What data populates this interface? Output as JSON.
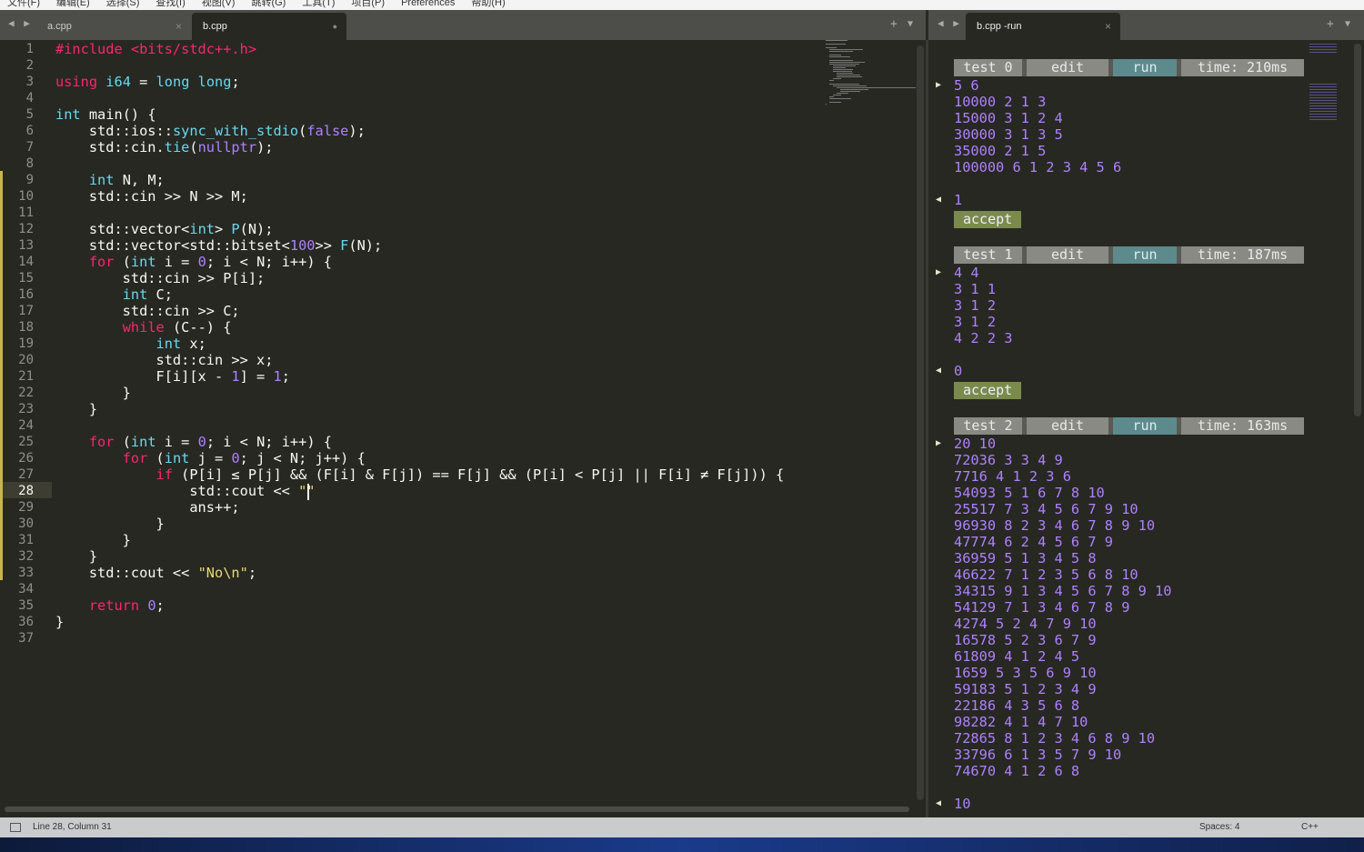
{
  "menu": [
    "文件(F)",
    "编辑(E)",
    "选择(S)",
    "查找(I)",
    "视图(V)",
    "跳转(G)",
    "工具(T)",
    "项目(P)",
    "Preferences",
    "帮助(H)"
  ],
  "left_tabs": [
    {
      "label": "a.cpp",
      "icon": "close-icon"
    },
    {
      "label": "b.cpp",
      "icon": "unsaved-dot-icon"
    }
  ],
  "right_tabs": [
    {
      "label": "b.cpp -run",
      "icon": "close-icon"
    }
  ],
  "icons": {
    "close": "×",
    "dot": "●",
    "nav": "◀ ▶",
    "plus": "+",
    "dropdown": "▼",
    "in_marker": "▶",
    "out_marker": "◀"
  },
  "colors": {
    "keyword": "#f92672",
    "type": "#66d9ef",
    "number": "#ae81ff",
    "string": "#e6db74",
    "background": "#272822"
  },
  "editor": {
    "current_line": 28,
    "lines": [
      [
        [
          "#include <bits/stdc++.h>",
          "k"
        ]
      ],
      [],
      [
        [
          "using",
          "k"
        ],
        [
          " "
        ],
        [
          "i64",
          "t"
        ],
        [
          " = "
        ],
        [
          "long long",
          "t"
        ],
        [
          ";"
        ]
      ],
      [],
      [
        [
          "int",
          "t"
        ],
        [
          " main() {"
        ]
      ],
      [
        [
          "    std::ios::"
        ],
        [
          "sync_with_stdio",
          "f"
        ],
        [
          "("
        ],
        [
          "false",
          "n"
        ],
        [
          ");"
        ]
      ],
      [
        [
          "    std::cin."
        ],
        [
          "tie",
          "f"
        ],
        [
          "("
        ],
        [
          "nullptr",
          "n"
        ],
        [
          ");"
        ]
      ],
      [],
      [
        [
          "    "
        ],
        [
          "int",
          "t"
        ],
        [
          " N, M;"
        ]
      ],
      [
        [
          "    std::cin >> N >> M;"
        ]
      ],
      [],
      [
        [
          "    std::vector<"
        ],
        [
          "int",
          "t"
        ],
        [
          "> "
        ],
        [
          "P",
          "f"
        ],
        [
          "(N);"
        ]
      ],
      [
        [
          "    std::vector<std::bitset<"
        ],
        [
          "100",
          "n"
        ],
        [
          ">> "
        ],
        [
          "F",
          "f"
        ],
        [
          "(N);"
        ]
      ],
      [
        [
          "    "
        ],
        [
          "for",
          "k"
        ],
        [
          " ("
        ],
        [
          "int",
          "t"
        ],
        [
          " i = "
        ],
        [
          "0",
          "n"
        ],
        [
          "; i < N; i++) {"
        ]
      ],
      [
        [
          "        std::cin >> P[i];"
        ]
      ],
      [
        [
          "        "
        ],
        [
          "int",
          "t"
        ],
        [
          " C;"
        ]
      ],
      [
        [
          "        std::cin >> C;"
        ]
      ],
      [
        [
          "        "
        ],
        [
          "while",
          "k"
        ],
        [
          " (C--) {"
        ]
      ],
      [
        [
          "            "
        ],
        [
          "int",
          "t"
        ],
        [
          " x;"
        ]
      ],
      [
        [
          "            std::cin >> x;"
        ]
      ],
      [
        [
          "            F[i][x - "
        ],
        [
          "1",
          "n"
        ],
        [
          "] = "
        ],
        [
          "1",
          "n"
        ],
        [
          ";"
        ]
      ],
      [
        [
          "        }"
        ]
      ],
      [
        [
          "    }"
        ]
      ],
      [],
      [
        [
          "    "
        ],
        [
          "for",
          "k"
        ],
        [
          " ("
        ],
        [
          "int",
          "t"
        ],
        [
          " i = "
        ],
        [
          "0",
          "n"
        ],
        [
          "; i < N; i++) {"
        ]
      ],
      [
        [
          "        "
        ],
        [
          "for",
          "k"
        ],
        [
          " ("
        ],
        [
          "int",
          "t"
        ],
        [
          " j = "
        ],
        [
          "0",
          "n"
        ],
        [
          "; j < N; j++) {"
        ]
      ],
      [
        [
          "            "
        ],
        [
          "if",
          "k"
        ],
        [
          " (P[i] ≤ P[j] && (F[i] & F[j]) == F[j] && (P[i] < P[j] || F[i] ≠ F[j])) {"
        ]
      ],
      [
        [
          "                std::cout << "
        ],
        [
          "\"\"",
          "s"
        ]
      ],
      [
        [
          "                ans++;"
        ]
      ],
      [
        [
          "            }"
        ]
      ],
      [
        [
          "        }"
        ]
      ],
      [
        [
          "    }"
        ]
      ],
      [
        [
          "    std::cout << "
        ],
        [
          "\"No\\n\"",
          "s"
        ],
        [
          ";"
        ]
      ],
      [],
      [
        [
          "    "
        ],
        [
          "return",
          "k"
        ],
        [
          " "
        ],
        [
          "0",
          "n"
        ],
        [
          ";"
        ]
      ],
      [
        [
          "}"
        ]
      ],
      []
    ]
  },
  "tests": [
    {
      "label": "test 0",
      "edit": "edit",
      "run": "run",
      "time": "time: 210ms",
      "input": [
        "5 6",
        "10000 2 1 3",
        "15000 3 1 2 4",
        "30000 3 1 3 5",
        "35000 2 1 5",
        "100000 6 1 2 3 4 5 6"
      ],
      "output": "1",
      "verdict": "accept"
    },
    {
      "label": "test 1",
      "edit": "edit",
      "run": "run",
      "time": "time: 187ms",
      "input": [
        "4 4",
        "3 1 1",
        "3 1 2",
        "3 1 2",
        "4 2 2 3"
      ],
      "output": "0",
      "verdict": "accept"
    },
    {
      "label": "test 2",
      "edit": "edit",
      "run": "run",
      "time": "time: 163ms",
      "input": [
        "20 10",
        "72036 3 3 4 9",
        "7716 4 1 2 3 6",
        "54093 5 1 6 7 8 10",
        "25517 7 3 4 5 6 7 9 10",
        "96930 8 2 3 4 6 7 8 9 10",
        "47774 6 2 4 5 6 7 9",
        "36959 5 1 3 4 5 8",
        "46622 7 1 2 3 5 6 8 10",
        "34315 9 1 3 4 5 6 7 8 9 10",
        "54129 7 1 3 4 6 7 8 9",
        "4274 5 2 4 7 9 10",
        "16578 5 2 3 6 7 9",
        "61809 4 1 2 4 5",
        "1659 5 3 5 6 9 10",
        "59183 5 1 2 3 4 9",
        "22186 4 3 5 6 8",
        "98282 4 1 4 7 10",
        "72865 8 1 2 3 4 6 8 9 10",
        "33796 6 1 3 5 7 9 10",
        "74670 4 1 2 6 8"
      ],
      "output": "10",
      "verdict": ""
    }
  ],
  "status": {
    "position": "Line 28, Column 31",
    "indent": "Spaces: 4",
    "syntax": "C++"
  }
}
